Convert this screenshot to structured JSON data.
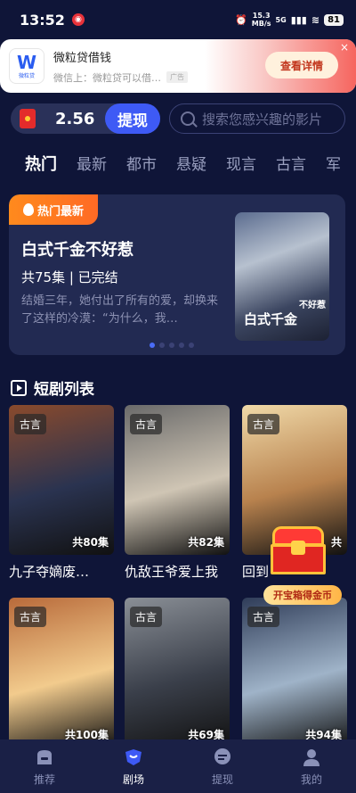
{
  "status_bar": {
    "time": "13:52",
    "speed_value": "15.3",
    "speed_unit": "MB/s",
    "network": "5G",
    "battery": "81"
  },
  "ad": {
    "logo_text": "W",
    "logo_sub": "微粒贷",
    "title": "微粒贷借钱",
    "description": "微信上：微粒贷可以借…",
    "tag": "广告",
    "button": "查看详情",
    "close": "×"
  },
  "wallet": {
    "amount": "2.56",
    "withdraw_label": "提现"
  },
  "search": {
    "placeholder": "搜索您感兴趣的影片"
  },
  "tabs": [
    "热门",
    "最新",
    "都市",
    "悬疑",
    "现言",
    "古言",
    "军"
  ],
  "featured": {
    "badge": "热门最新",
    "title": "白式千金不好惹",
    "meta": "共75集 | 已完结",
    "description": "结婚三年，她付出了所有的爱，却换来了这样的冷漠：“为什么，我…",
    "poster_small": "不好惹",
    "poster_big": "白式千金"
  },
  "section": {
    "title": "短剧列表"
  },
  "dramas": [
    {
      "genre": "古言",
      "episodes": "共80集",
      "title": "九子夺嫡废…",
      "c1": "#2a3350",
      "c2": "#8a4a2c"
    },
    {
      "genre": "古言",
      "episodes": "共82集",
      "title": "仇敌王爷爱上我",
      "c1": "#cfc5b4",
      "c2": "#6a6a6a"
    },
    {
      "genre": "古言",
      "episodes": "共",
      "title": "回到",
      "c1": "#b8824e",
      "c2": "#f0d9a8"
    },
    {
      "genre": "古言",
      "episodes": "共100集",
      "title": "",
      "c1": "#f2cb8d",
      "c2": "#b86a3a"
    },
    {
      "genre": "古言",
      "episodes": "共69集",
      "title": "",
      "c1": "#3a3f4a",
      "c2": "#8a8f96"
    },
    {
      "genre": "古言",
      "episodes": "共94集",
      "title": "",
      "c1": "#9fb3c8",
      "c2": "#2f3c58"
    }
  ],
  "chest": {
    "label": "开宝箱得金币"
  },
  "nav": [
    {
      "label": "推荐",
      "active": false
    },
    {
      "label": "剧场",
      "active": true
    },
    {
      "label": "提现",
      "active": false
    },
    {
      "label": "我的",
      "active": false
    }
  ],
  "colors": {
    "background": "#0f1538",
    "accent": "#3e5af5",
    "badge": "#ff7a1e"
  }
}
